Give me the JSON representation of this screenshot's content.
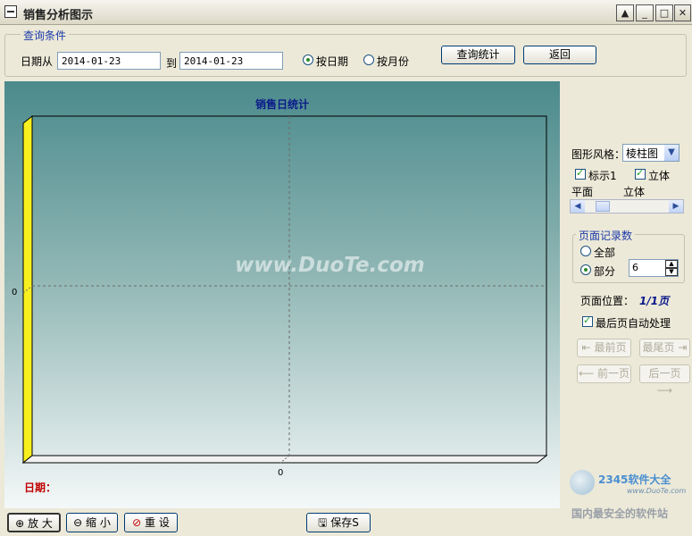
{
  "window": {
    "title": "销售分析图示"
  },
  "query": {
    "legend": "查询条件",
    "date_from_label": "日期从",
    "date_from": "2014-01-23",
    "to_label": "到",
    "date_to": "2014-01-23",
    "by_date_label": "按日期",
    "by_month_label": "按月份",
    "query_button": "查询统计",
    "back_button": "返回"
  },
  "chart_data": {
    "type": "bar",
    "title": "销售日统计",
    "categories": [],
    "values": [],
    "x_tick": "0",
    "y_tick": "0",
    "date_label": "日期：",
    "watermark": "www.DuoTe.com"
  },
  "side": {
    "style_label": "图形风格：",
    "style_value": "棱柱图",
    "mark_label": "标示1",
    "stereo_label": "立体",
    "flat_label": "平面",
    "stereo2_label": "立体",
    "page_records_legend": "页面记录数",
    "all_label": "全部",
    "part_label": "部分",
    "part_value": "6",
    "page_pos_label": "页面位置：",
    "page_pos_value": "1/1页",
    "auto_last_label": "最后页自动处理",
    "first_page": "最前页",
    "last_page": "最尾页",
    "prev_page": "前一页",
    "next_page": "后一页"
  },
  "bottom": {
    "zoom_in": "放 大",
    "zoom_out": "缩 小",
    "reset": "重 设",
    "save": "保存S"
  },
  "logo": {
    "brand": "2345软件大全",
    "url": "www.DuoTe.com",
    "slogan": "国内最安全的软件站"
  }
}
